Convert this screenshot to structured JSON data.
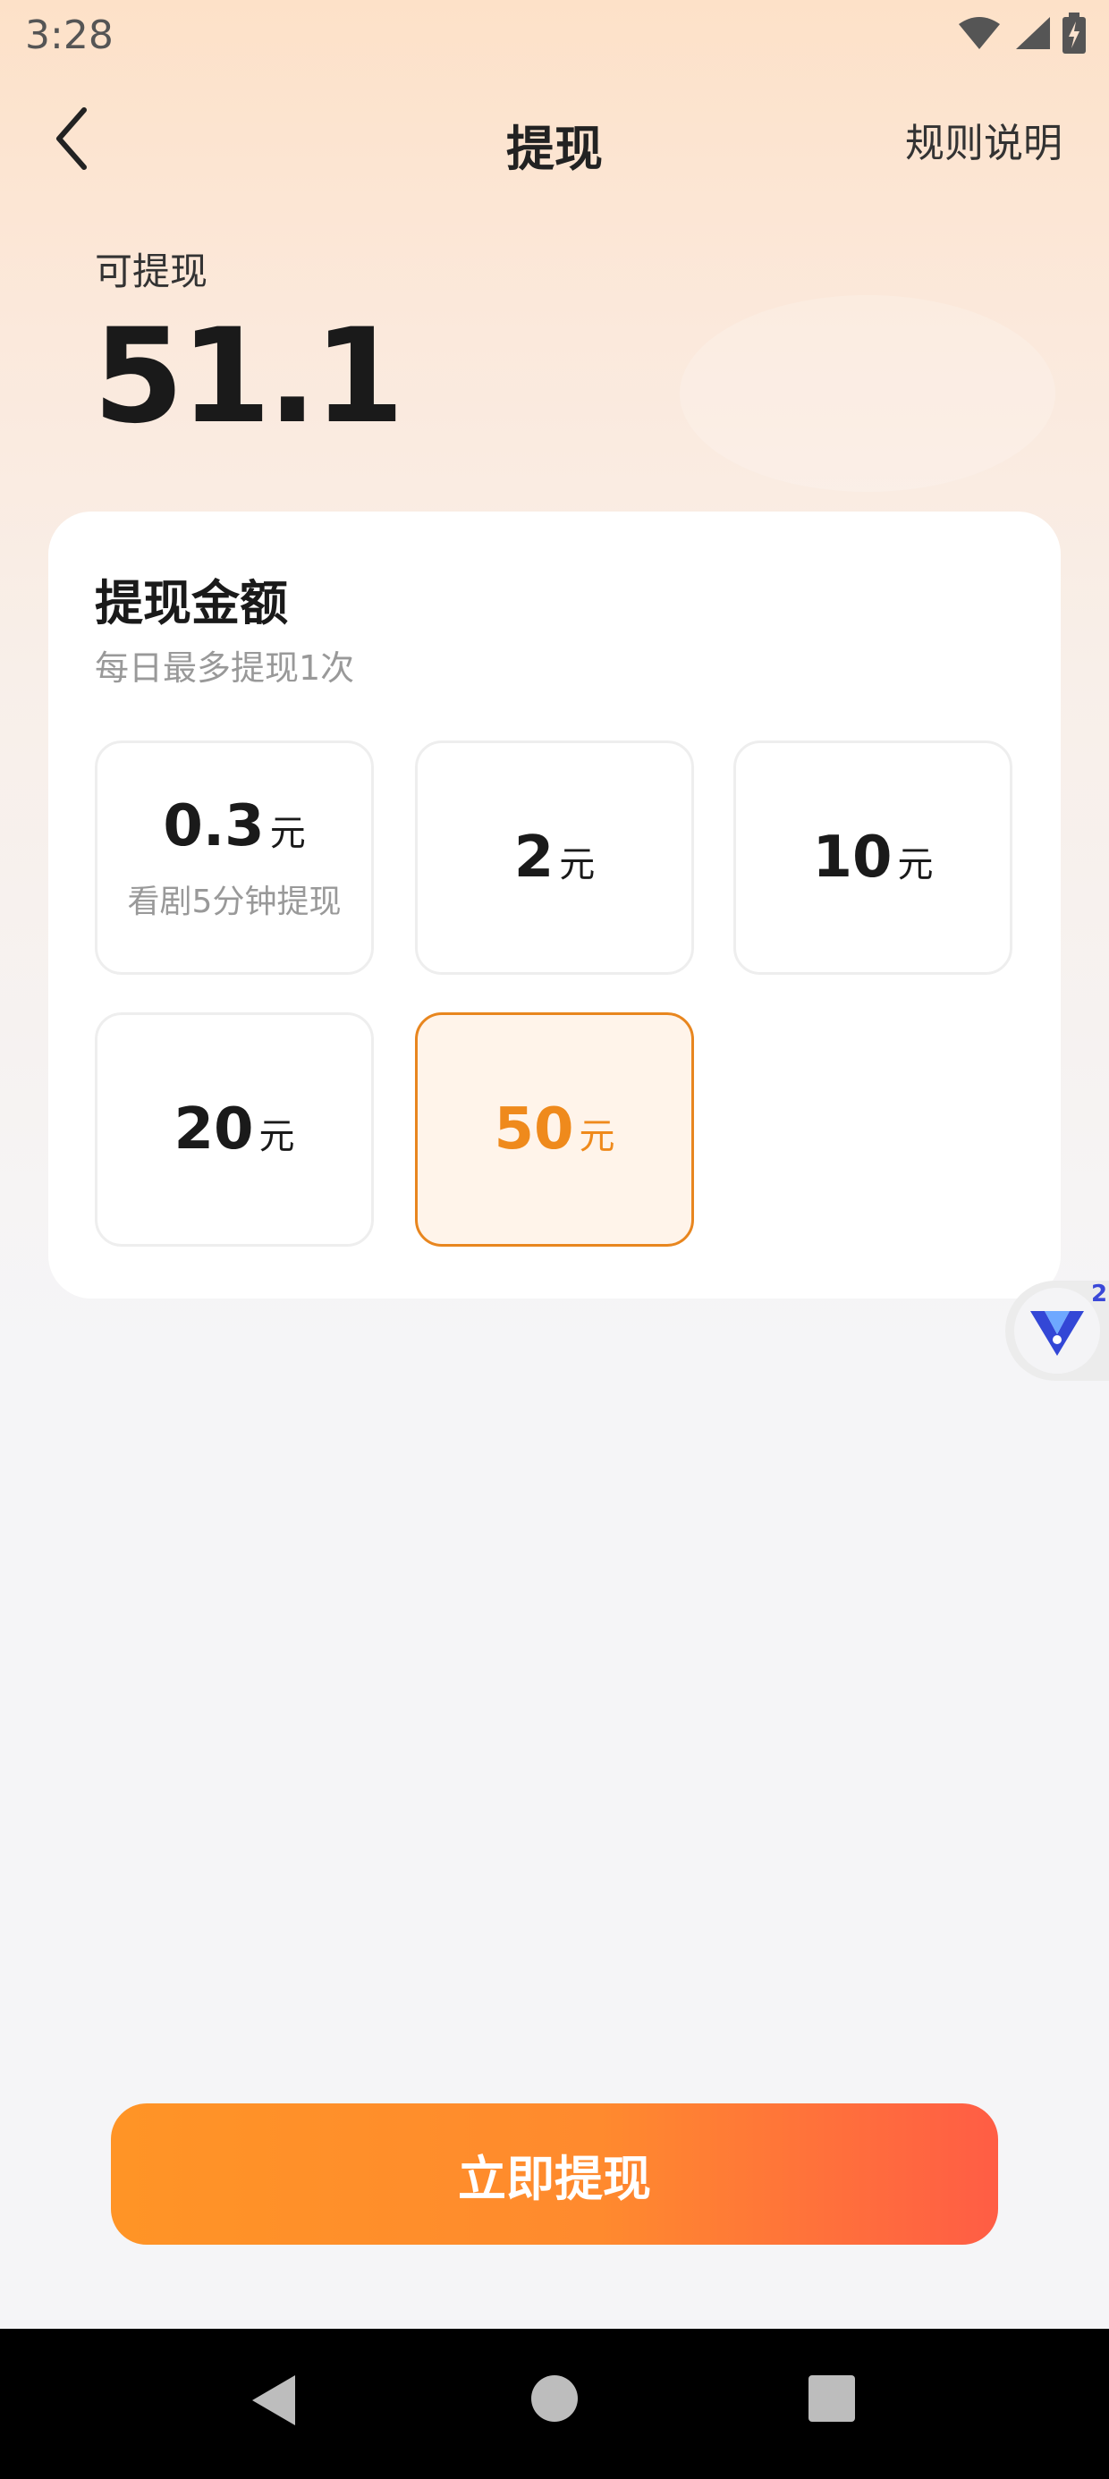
{
  "status_bar": {
    "time": "3:28",
    "icons": [
      "wifi-icon",
      "signal-icon",
      "battery-charging-icon"
    ]
  },
  "nav": {
    "back_icon": "chevron-left-icon",
    "title": "提现",
    "rules_label": "规则说明"
  },
  "balance": {
    "label": "可提现",
    "value": "51.1"
  },
  "amount_card": {
    "title": "提现金额",
    "subtitle": "每日最多提现1次",
    "selected_index": 4,
    "options": [
      {
        "amount": "0.3",
        "unit": "元",
        "note": "看剧5分钟提现"
      },
      {
        "amount": "2",
        "unit": "元"
      },
      {
        "amount": "10",
        "unit": "元"
      },
      {
        "amount": "20",
        "unit": "元"
      },
      {
        "amount": "50",
        "unit": "元"
      }
    ]
  },
  "float_badge": {
    "icon": "v-logo-icon",
    "count": "2"
  },
  "withdraw_button": {
    "label": "立即提现"
  },
  "colors": {
    "accent": "#ef8a1c",
    "button_start": "#ff9426",
    "button_end": "#ff5d45"
  },
  "system_nav": {
    "icons": [
      "back-triangle-icon",
      "home-circle-icon",
      "recents-square-icon"
    ]
  }
}
